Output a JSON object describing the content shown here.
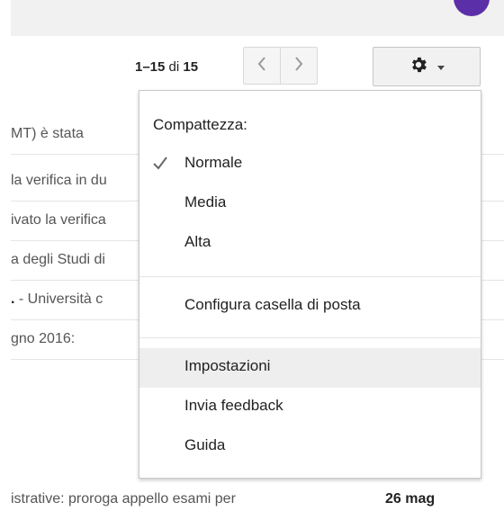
{
  "pager": {
    "range": "1–15",
    "of_word": "di",
    "total": "15"
  },
  "menu": {
    "header": "Compattezza:",
    "density": [
      {
        "label": "Normale",
        "checked": true
      },
      {
        "label": "Media",
        "checked": false
      },
      {
        "label": "Alta",
        "checked": false
      }
    ],
    "configure": "Configura casella di posta",
    "settings": "Impostazioni",
    "feedback": "Invia feedback",
    "help": "Guida"
  },
  "mail_rows": [
    {
      "snippet": "MT) è stata"
    },
    {
      "snippet": "la verifica in du"
    },
    {
      "snippet": "ivato la verifica"
    },
    {
      "snippet": "a degli Studi di"
    },
    {
      "snippet_bold": ".",
      "snippet_rest": " - Università c"
    },
    {
      "snippet": "gno 2016:"
    },
    {
      "snippet": "istrative: proroga appello esami per",
      "date": "26 mag"
    }
  ],
  "colors": {
    "avatar": "#5b2fa8",
    "highlight": "#eeeeee"
  }
}
